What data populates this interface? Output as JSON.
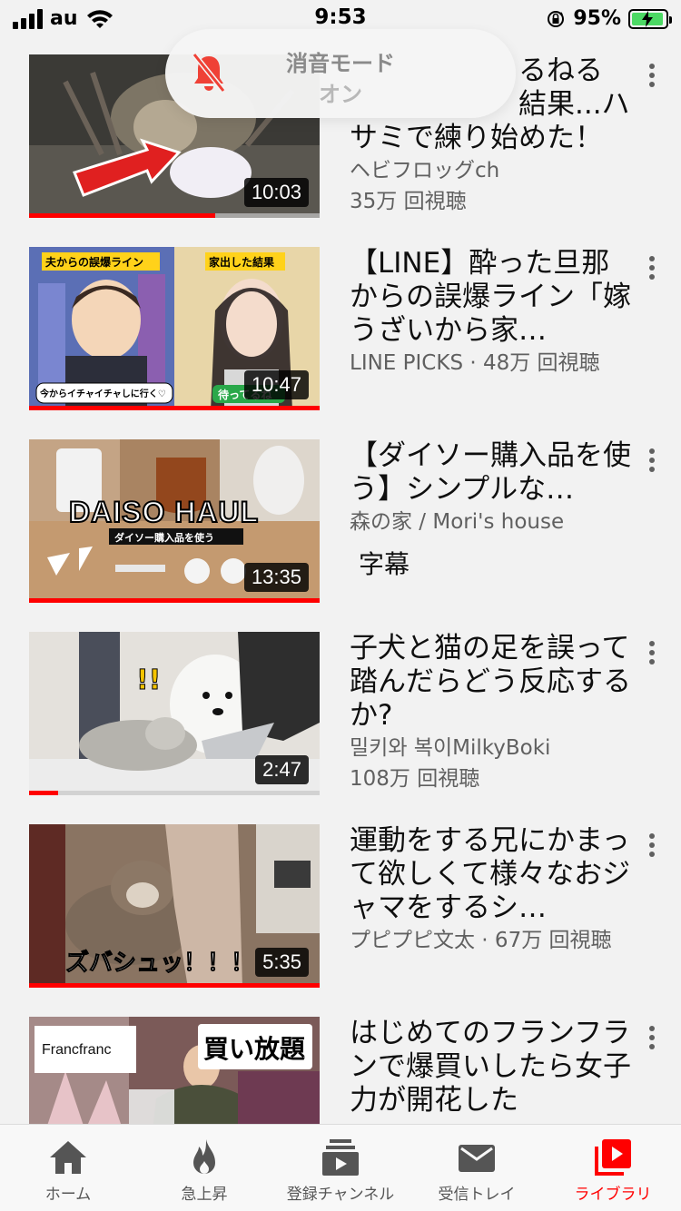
{
  "status_bar": {
    "carrier": "au",
    "time": "9:53",
    "battery_percent": "95%",
    "battery_level": 0.95
  },
  "toast": {
    "title": "消音モード",
    "subtitle": "オン",
    "icon": "bell-slash-icon"
  },
  "videos": [
    {
      "title": "ヘビにちょっかいかけるねるカニ...その結果...ハサミで練り始めた！",
      "visible_title_lines": [
        "るねる",
        "結果...ハ",
        "サミで練り始めた！"
      ],
      "channel": "ヘビフロッグch",
      "views": "35万 回視聴",
      "duration": "10:03",
      "watched_fraction": 0.64
    },
    {
      "title": "【LINE】酔った旦那からの誤爆ライン「嫁うざいから家…",
      "meta": "LINE PICKS · 48万 回視聴",
      "duration": "10:47",
      "watched_fraction": 1.0,
      "thumb_labels": [
        "夫からの誤爆ライン",
        "家出した結果",
        "今からイチャイチャしに行く♡",
        "待ってるね"
      ]
    },
    {
      "title": "【ダイソー購入品を使う】シンプルな…",
      "channel": "森の家 / Mori's house",
      "caption": "字幕",
      "duration": "13:35",
      "watched_fraction": 1.0,
      "thumb_labels": [
        "DAISO HAUL",
        "ダイソー購入品を使う"
      ]
    },
    {
      "title": "子犬と猫の足を誤って踏んだらどう反応するか?",
      "channel": "밀키와 복이MilkyBoki",
      "views": "108万 回視聴",
      "duration": "2:47",
      "watched_fraction": 0.1,
      "thumb_labels": [
        "!!"
      ]
    },
    {
      "title": "運動をする兄にかまって欲しくて様々なおジャマをするシ…",
      "meta": "プピプピ文太 · 67万 回視聴",
      "duration": "5:35",
      "watched_fraction": 1.0,
      "thumb_labels": [
        "ズバシュッ！！！"
      ]
    },
    {
      "title": "はじめてのフランフランで爆買いしたら女子力が開花した",
      "thumb_labels": [
        "Francfranc",
        "買い放題"
      ]
    }
  ],
  "bottom_nav": [
    {
      "label": "ホーム",
      "icon": "home-icon",
      "active": false
    },
    {
      "label": "急上昇",
      "icon": "flame-icon",
      "active": false
    },
    {
      "label": "登録チャンネル",
      "icon": "subscriptions-icon",
      "active": false
    },
    {
      "label": "受信トレイ",
      "icon": "mail-icon",
      "active": false
    },
    {
      "label": "ライブラリ",
      "icon": "library-icon",
      "active": true
    }
  ],
  "colors": {
    "accent": "#ff0000",
    "background": "#f2f2f2",
    "text_secondary": "#606060"
  }
}
